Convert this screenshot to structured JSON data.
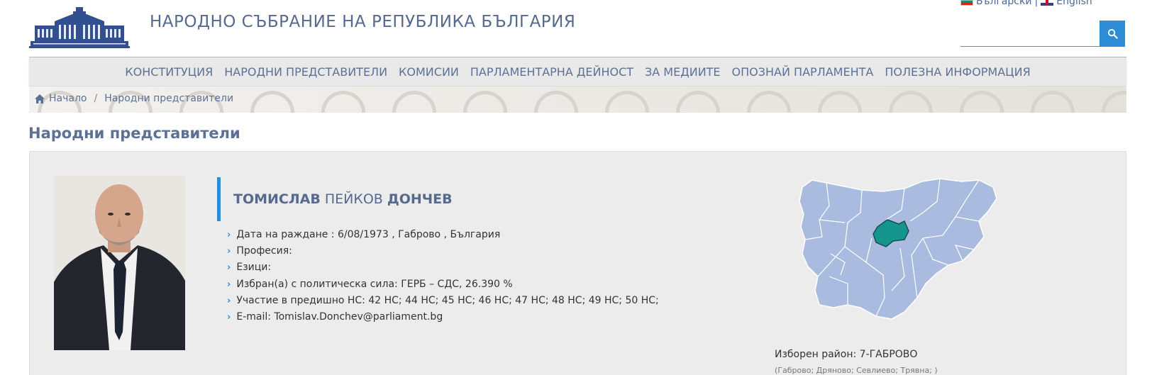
{
  "lang": {
    "bg_label": "Български",
    "separator": "|",
    "en_label": "English"
  },
  "search": {
    "placeholder": "",
    "icon": "search-icon"
  },
  "header": {
    "title": "НАРОДНО СЪБРАНИЕ НА РЕПУБЛИКА БЪЛГАРИЯ"
  },
  "nav": {
    "items": [
      {
        "label": "КОНСТИТУЦИЯ"
      },
      {
        "label": "НАРОДНИ ПРЕДСТАВИТЕЛИ"
      },
      {
        "label": "КОМИСИИ"
      },
      {
        "label": "ПАРЛАМЕНТАРНА ДЕЙНОСТ"
      },
      {
        "label": "ЗА МЕДИИТЕ"
      },
      {
        "label": "ОПОЗНАЙ ПАРЛАМЕНТА"
      },
      {
        "label": "ПОЛЕЗНА ИНФОРМАЦИЯ"
      }
    ]
  },
  "breadcrumb": {
    "home": "Начало",
    "sep": "/",
    "current": "Народни представители"
  },
  "page": {
    "heading": "Народни представители"
  },
  "mp": {
    "first_name": "ТОМИСЛАВ",
    "middle_name": "ПЕЙКОВ",
    "last_name": "ДОНЧЕВ",
    "details": [
      "Дата на раждане : 6/08/1973 , Габрово , България",
      "Професия:",
      "Езици:",
      "Избран(а) с политическа сила: ГЕРБ – СДС, 26.390 %",
      "Участие в предишно НС: 42 НС; 44 НС; 45 НС; 46 НС; 47 НС; 48 НС; 49 НС; 50 НС;",
      "E-mail: Tomislav.Donchev@parliament.bg"
    ],
    "district": "Изборен район: 7-ГАБРОВО",
    "district_towns": "(Габрово; Дряново; Севлиево; Трявна; )"
  },
  "colors": {
    "accent": "#2d8cd6",
    "title": "#56698f",
    "map_region": "#a9bbdf",
    "map_highlight": "#14968f"
  }
}
